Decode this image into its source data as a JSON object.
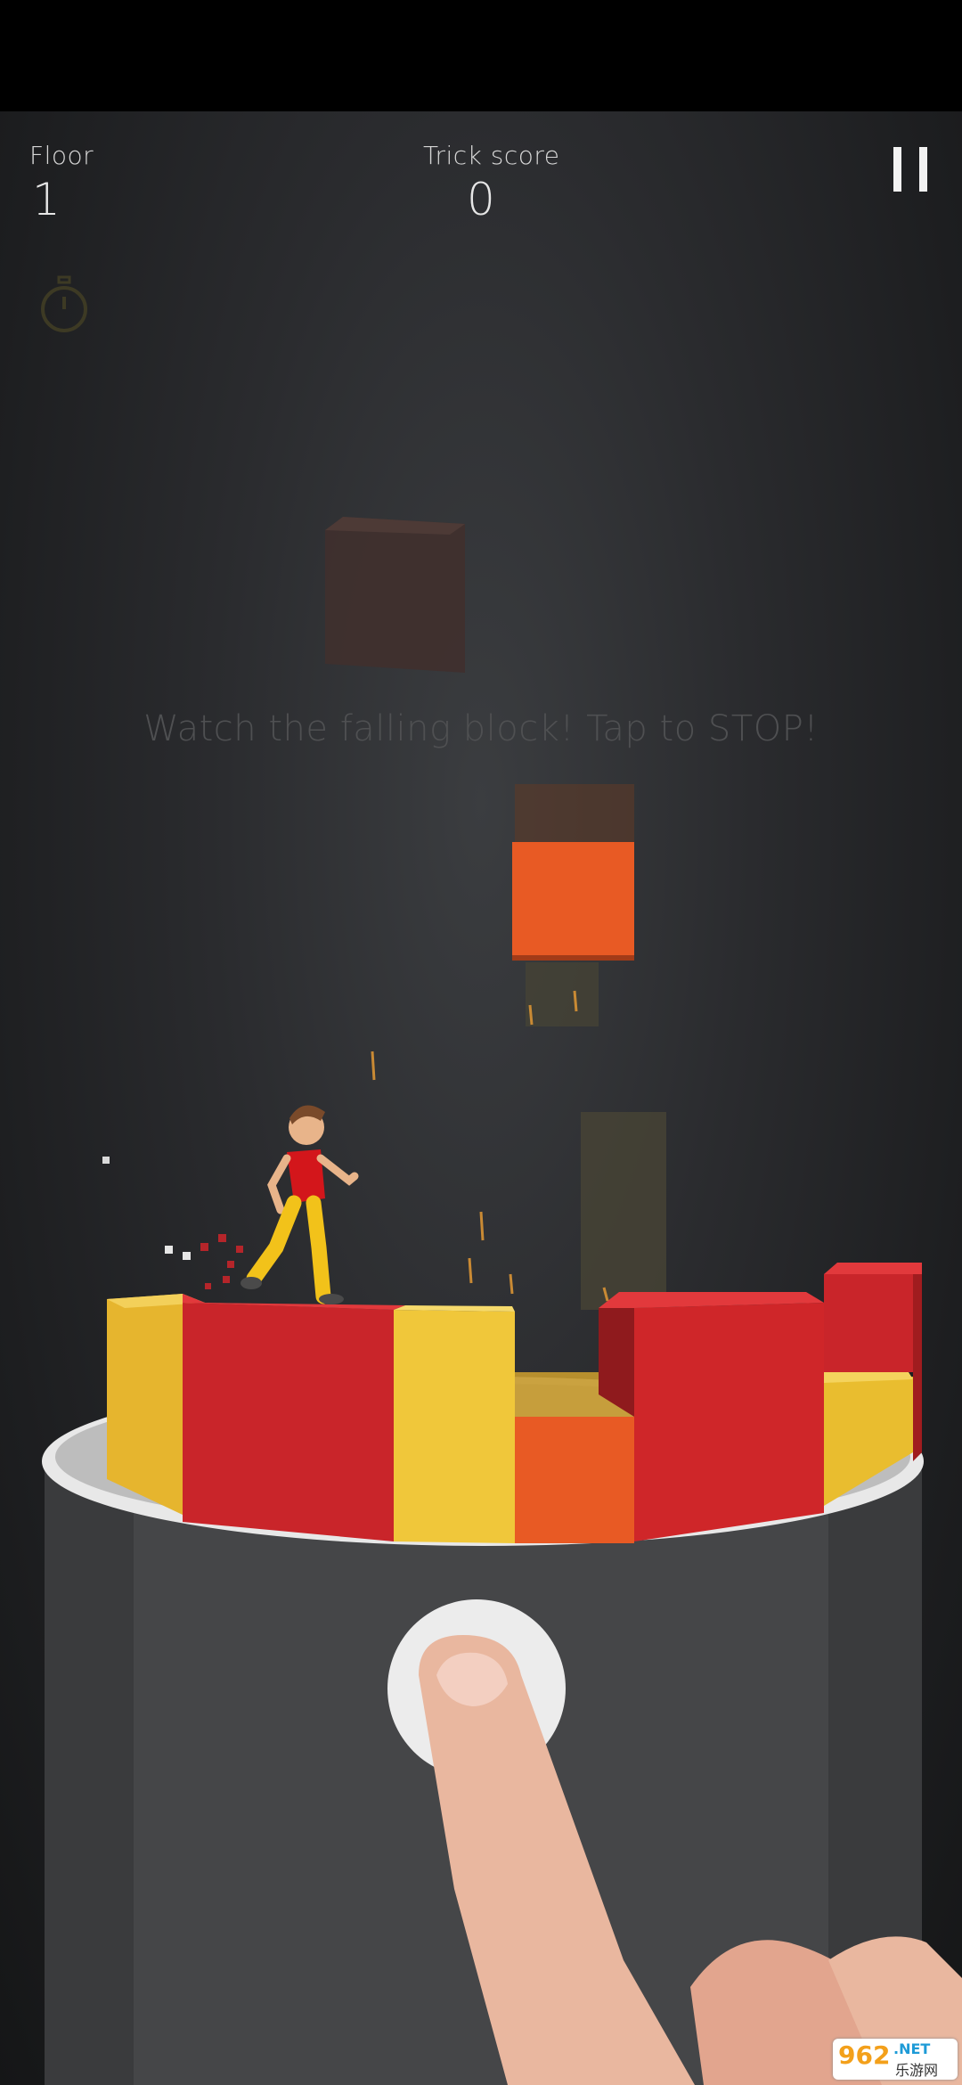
{
  "hud": {
    "floor_label": "Floor",
    "floor_value": "1",
    "trick_label": "Trick score",
    "trick_value": "0"
  },
  "hint_text": "Watch the falling block! Tap to STOP!",
  "icons": {
    "pause": "pause-icon",
    "timer": "stopwatch-icon",
    "watermark": "962 NET 乐游网"
  },
  "watermark": {
    "brand": "962",
    "net": ".NET",
    "cn": "乐游网"
  },
  "colors": {
    "block_red": "#d12a2e",
    "block_yellow": "#f0c73a",
    "block_orange": "#e85a24",
    "background": "#2a2b2e"
  }
}
